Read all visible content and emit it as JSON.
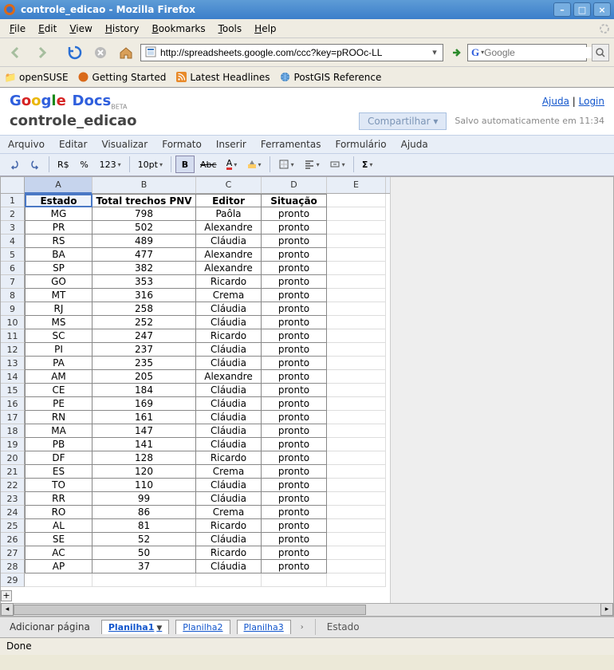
{
  "window": {
    "title": "controle_edicao - Mozilla Firefox"
  },
  "browser_menu": [
    "File",
    "Edit",
    "View",
    "History",
    "Bookmarks",
    "Tools",
    "Help"
  ],
  "url": "http://spreadsheets.google.com/ccc?key=pROOc-LL",
  "search_placeholder": "Google",
  "bookmarks": [
    {
      "label": "openSUSE"
    },
    {
      "label": "Getting Started"
    },
    {
      "label": "Latest Headlines"
    },
    {
      "label": "PostGIS Reference"
    }
  ],
  "gdocs": {
    "links": {
      "help": "Ajuda",
      "login": "Login"
    },
    "doc_title": "controle_edicao",
    "share_label": "Compartilhar",
    "autosave": "Salvo automaticamente em 11:34",
    "menu": [
      "Arquivo",
      "Editar",
      "Visualizar",
      "Formato",
      "Inserir",
      "Ferramentas",
      "Formulário",
      "Ajuda"
    ],
    "toolbar": {
      "currency": "R$",
      "percent": "%",
      "numfmt": "123",
      "fontsize": "10pt",
      "bold": "B",
      "abc": "Abc"
    }
  },
  "columns": [
    "A",
    "B",
    "C",
    "D",
    "E"
  ],
  "headers": [
    "Estado",
    "Total trechos PNV",
    "Editor",
    "Situação"
  ],
  "rows": [
    [
      "MG",
      "798",
      "Paôla",
      "pronto"
    ],
    [
      "PR",
      "502",
      "Alexandre",
      "pronto"
    ],
    [
      "RS",
      "489",
      "Cláudia",
      "pronto"
    ],
    [
      "BA",
      "477",
      "Alexandre",
      "pronto"
    ],
    [
      "SP",
      "382",
      "Alexandre",
      "pronto"
    ],
    [
      "GO",
      "353",
      "Ricardo",
      "pronto"
    ],
    [
      "MT",
      "316",
      "Crema",
      "pronto"
    ],
    [
      "RJ",
      "258",
      "Cláudia",
      "pronto"
    ],
    [
      "MS",
      "252",
      "Cláudia",
      "pronto"
    ],
    [
      "SC",
      "247",
      "Ricardo",
      "pronto"
    ],
    [
      "PI",
      "237",
      "Cláudia",
      "pronto"
    ],
    [
      "PA",
      "235",
      "Cláudia",
      "pronto"
    ],
    [
      "AM",
      "205",
      "Alexandre",
      "pronto"
    ],
    [
      "CE",
      "184",
      "Cláudia",
      "pronto"
    ],
    [
      "PE",
      "169",
      "Cláudia",
      "pronto"
    ],
    [
      "RN",
      "161",
      "Cláudia",
      "pronto"
    ],
    [
      "MA",
      "147",
      "Cláudia",
      "pronto"
    ],
    [
      "PB",
      "141",
      "Cláudia",
      "pronto"
    ],
    [
      "DF",
      "128",
      "Ricardo",
      "pronto"
    ],
    [
      "ES",
      "120",
      "Crema",
      "pronto"
    ],
    [
      "TO",
      "110",
      "Cláudia",
      "pronto"
    ],
    [
      "RR",
      "99",
      "Cláudia",
      "pronto"
    ],
    [
      "RO",
      "86",
      "Crema",
      "pronto"
    ],
    [
      "AL",
      "81",
      "Ricardo",
      "pronto"
    ],
    [
      "SE",
      "52",
      "Cláudia",
      "pronto"
    ],
    [
      "AC",
      "50",
      "Ricardo",
      "pronto"
    ],
    [
      "AP",
      "37",
      "Cláudia",
      "pronto"
    ]
  ],
  "sheet_tabs": {
    "add": "Adicionar página",
    "tabs": [
      "Planilha1",
      "Planilha2",
      "Planilha3"
    ],
    "cellname": "Estado"
  },
  "status": "Done"
}
